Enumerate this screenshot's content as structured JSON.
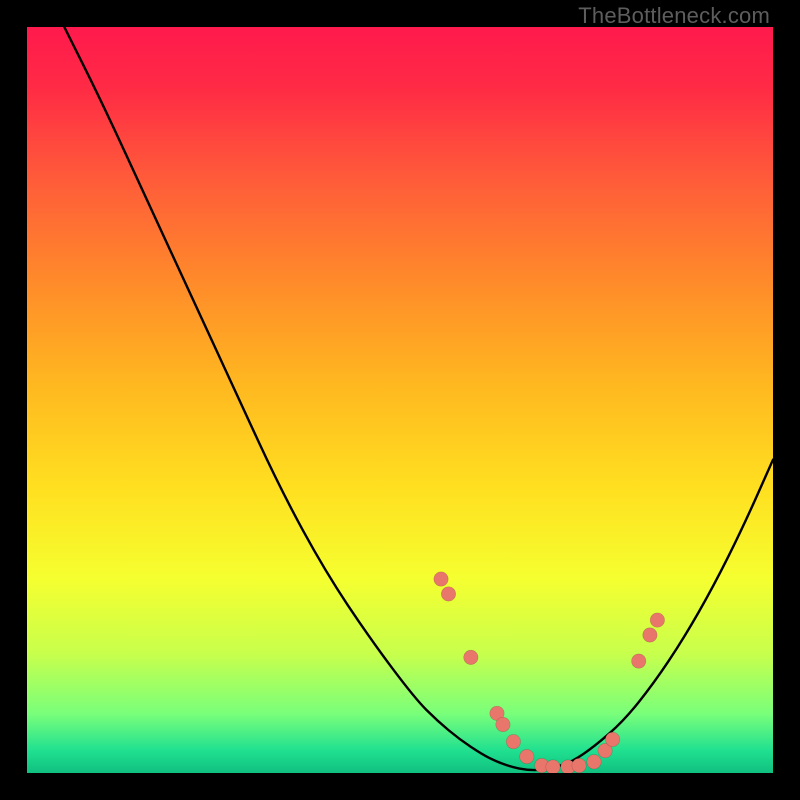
{
  "watermark": "TheBottleneck.com",
  "colors": {
    "background": "#000000",
    "curve": "#000000",
    "dot": "#e9766b"
  },
  "chart_data": {
    "type": "line",
    "title": "",
    "xlabel": "",
    "ylabel": "",
    "xlim": [
      0,
      100
    ],
    "ylim": [
      0,
      100
    ],
    "grid": false,
    "legend": false,
    "series": [
      {
        "name": "curve",
        "x": [
          5,
          10,
          16,
          22,
          28,
          34,
          40,
          46,
          52,
          55,
          58,
          61,
          63,
          65,
          67,
          69,
          71,
          73,
          76,
          80,
          84,
          88,
          92,
          96,
          100
        ],
        "y": [
          100,
          90,
          77,
          64,
          51,
          38,
          27,
          18,
          10,
          7,
          4.5,
          2.5,
          1.5,
          0.8,
          0.4,
          0.4,
          0.8,
          1.5,
          3.5,
          7,
          12,
          18,
          25,
          33,
          42
        ]
      }
    ],
    "points": [
      {
        "name": "p1",
        "x": 55.5,
        "y": 26
      },
      {
        "name": "p2",
        "x": 56.5,
        "y": 24
      },
      {
        "name": "p3",
        "x": 59.5,
        "y": 15.5
      },
      {
        "name": "p4",
        "x": 63,
        "y": 8
      },
      {
        "name": "p5",
        "x": 63.8,
        "y": 6.5
      },
      {
        "name": "p6",
        "x": 65.2,
        "y": 4.2
      },
      {
        "name": "p7",
        "x": 67,
        "y": 2.2
      },
      {
        "name": "p8",
        "x": 69,
        "y": 1
      },
      {
        "name": "p9",
        "x": 70.5,
        "y": 0.8
      },
      {
        "name": "p10",
        "x": 72.5,
        "y": 0.8
      },
      {
        "name": "p11",
        "x": 74,
        "y": 1
      },
      {
        "name": "p12",
        "x": 76,
        "y": 1.5
      },
      {
        "name": "p13",
        "x": 77.5,
        "y": 3
      },
      {
        "name": "p14",
        "x": 78.5,
        "y": 4.5
      },
      {
        "name": "p15",
        "x": 82,
        "y": 15
      },
      {
        "name": "p16",
        "x": 83.5,
        "y": 18.5
      },
      {
        "name": "p17",
        "x": 84.5,
        "y": 20.5
      }
    ]
  }
}
